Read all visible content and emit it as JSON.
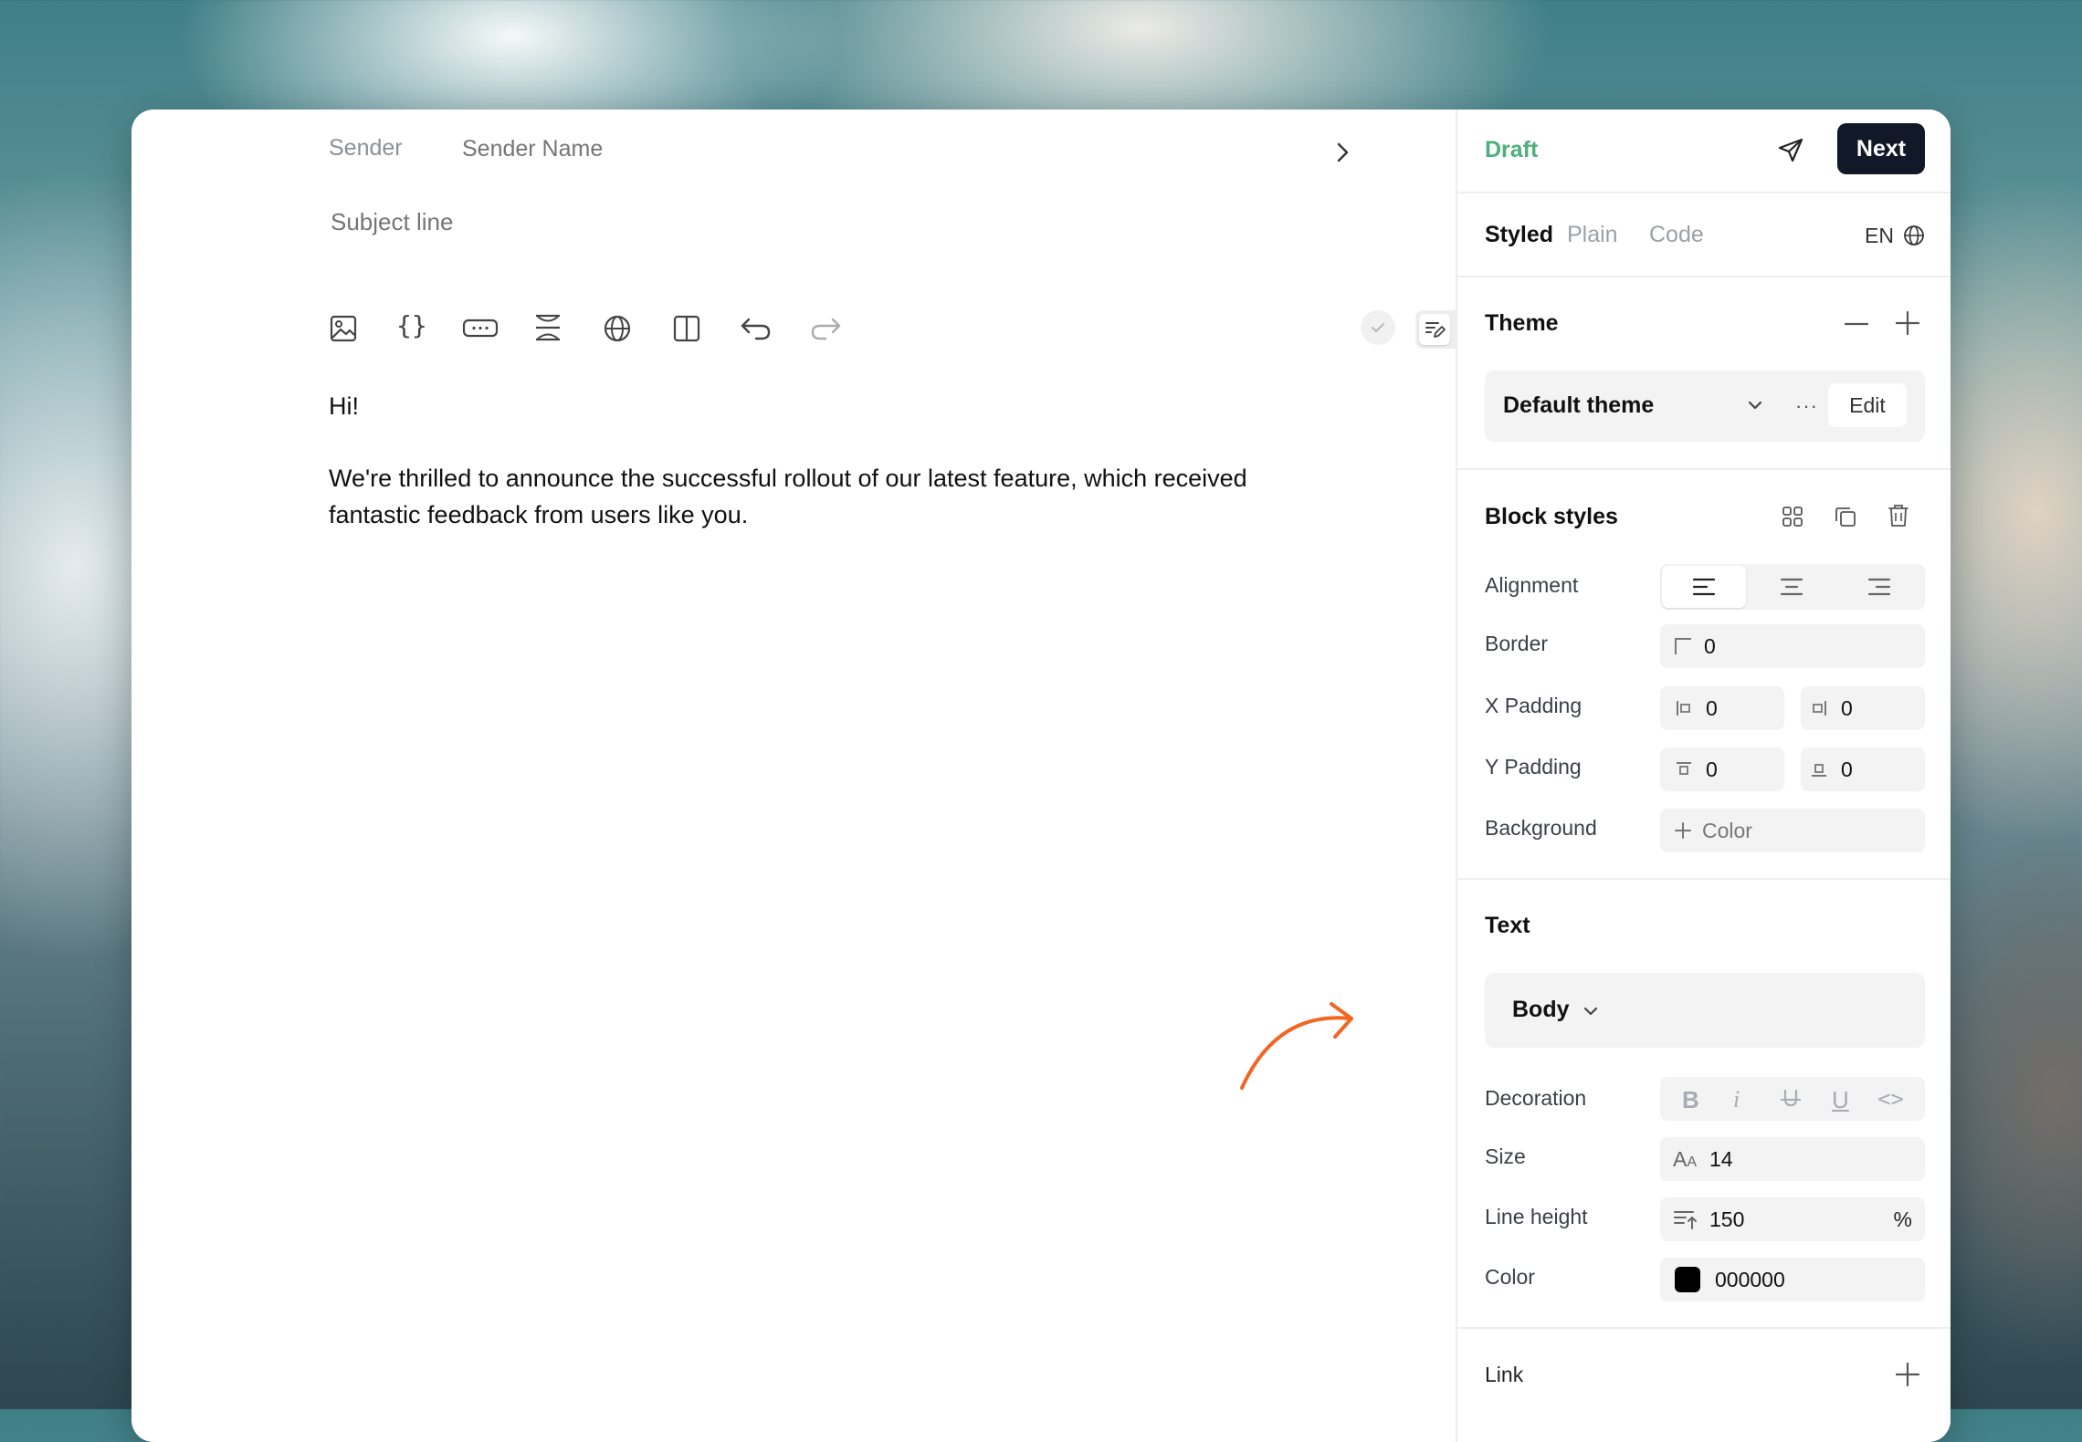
{
  "editor": {
    "sender_label": "Sender",
    "sender_name_placeholder": "Sender Name",
    "subject_placeholder": "Subject line",
    "toolbar": [
      "image-icon",
      "braces-icon",
      "button-block-icon",
      "divider-block-icon",
      "globe-icon",
      "columns-icon",
      "undo-icon",
      "redo-icon"
    ],
    "body": {
      "greeting": "Hi!",
      "paragraph_line1": "We're thrilled to announce the successful rollout of our latest feature, which received",
      "paragraph_line2": "fantastic feedback from users like you."
    },
    "accent_color": "#f26522"
  },
  "header": {
    "status": "Draft",
    "status_color": "#4caf7d",
    "next_label": "Next"
  },
  "mode_tabs": {
    "styled": "Styled",
    "plain": "Plain",
    "code": "Code",
    "active": "Styled",
    "language": "EN"
  },
  "theme": {
    "title": "Theme",
    "selected": "Default theme",
    "edit_label": "Edit"
  },
  "block_styles": {
    "title": "Block styles",
    "alignment_label": "Alignment",
    "alignment_selected": "left",
    "border_label": "Border",
    "border_value": "0",
    "x_padding_label": "X Padding",
    "x_padding_left": "0",
    "x_padding_right": "0",
    "y_padding_label": "Y Padding",
    "y_padding_top": "0",
    "y_padding_bottom": "0",
    "background_label": "Background",
    "background_value": "Color"
  },
  "text": {
    "title": "Text",
    "style": "Body",
    "decoration_label": "Decoration",
    "decorations": [
      "B",
      "i",
      "U",
      "<>"
    ],
    "size_label": "Size",
    "size_value": "14",
    "line_height_label": "Line height",
    "line_height_value": "150",
    "line_height_unit": "%",
    "color_label": "Color",
    "color_value": "000000",
    "color_swatch": "#000000"
  },
  "link": {
    "title": "Link"
  }
}
